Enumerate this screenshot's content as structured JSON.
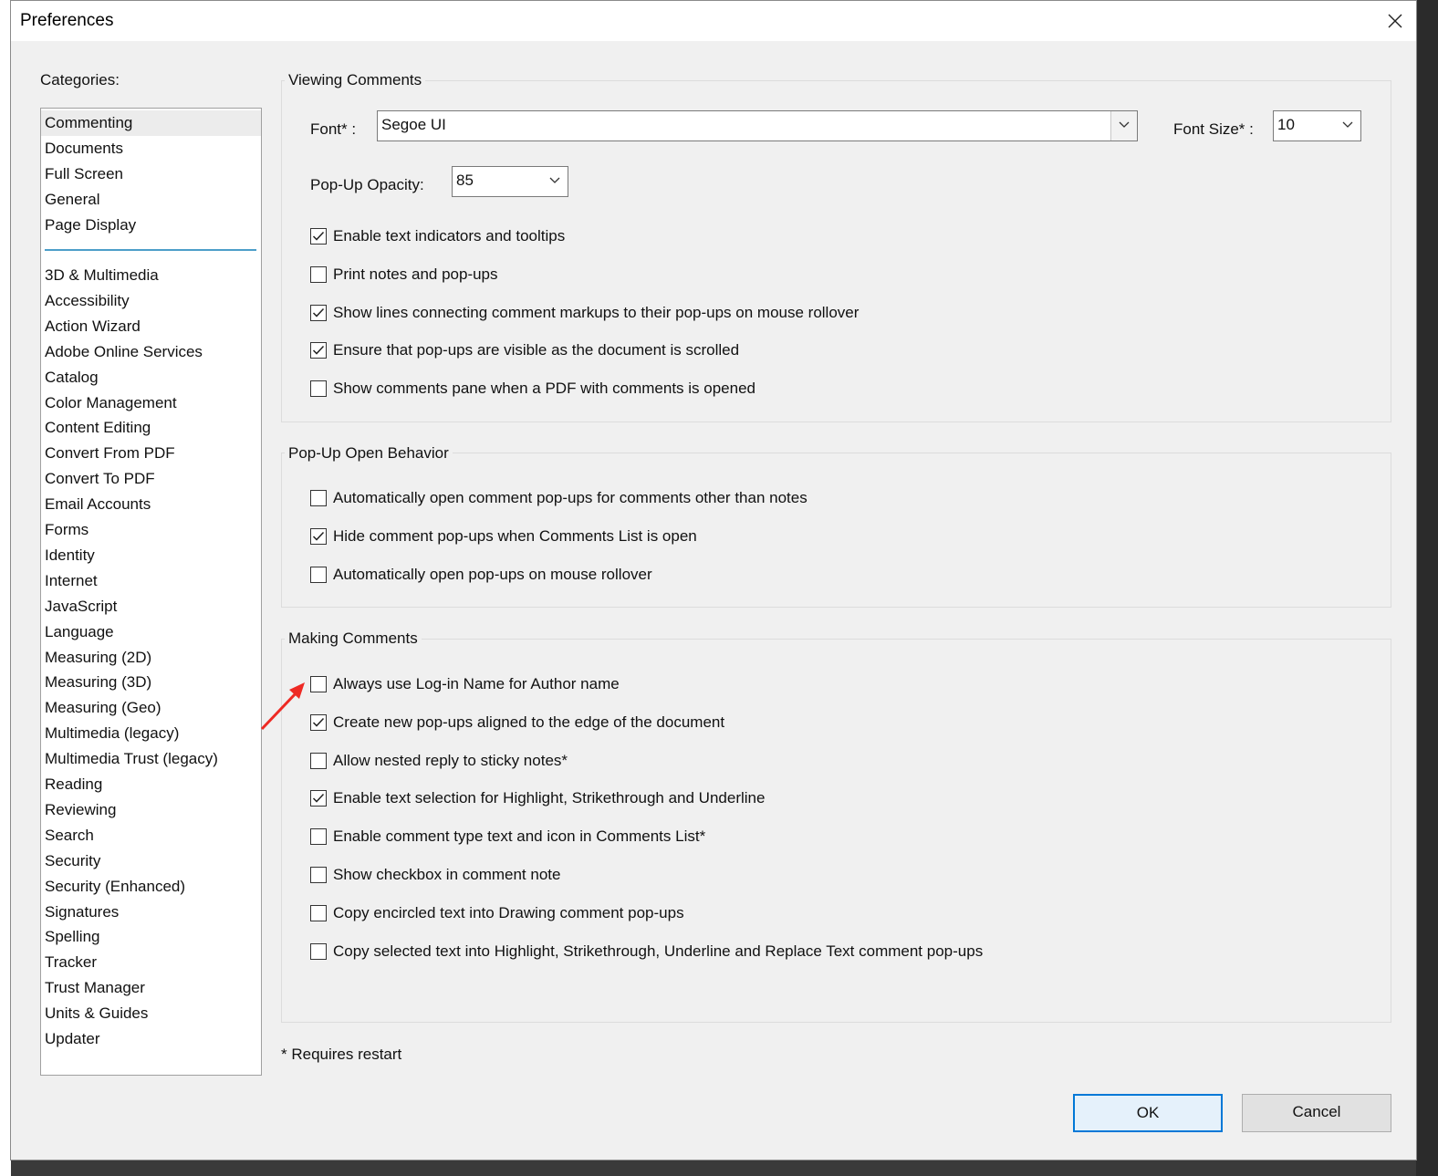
{
  "window": {
    "title": "Preferences"
  },
  "sidebar": {
    "label": "Categories:",
    "top_items": [
      "Commenting",
      "Documents",
      "Full Screen",
      "General",
      "Page Display"
    ],
    "selected": "Commenting",
    "items": [
      "3D & Multimedia",
      "Accessibility",
      "Action Wizard",
      "Adobe Online Services",
      "Catalog",
      "Color Management",
      "Content Editing",
      "Convert From PDF",
      "Convert To PDF",
      "Email Accounts",
      "Forms",
      "Identity",
      "Internet",
      "JavaScript",
      "Language",
      "Measuring (2D)",
      "Measuring (3D)",
      "Measuring (Geo)",
      "Multimedia (legacy)",
      "Multimedia Trust (legacy)",
      "Reading",
      "Reviewing",
      "Search",
      "Security",
      "Security (Enhanced)",
      "Signatures",
      "Spelling",
      "Tracker",
      "Trust Manager",
      "Units & Guides",
      "Updater"
    ]
  },
  "viewing": {
    "title": "Viewing Comments",
    "font_label": "Font* :",
    "font_value": "Segoe UI",
    "font_size_label": "Font Size* :",
    "font_size_value": "10",
    "opacity_label": "Pop-Up Opacity:",
    "opacity_value": "85",
    "options": [
      {
        "label": "Enable text indicators and tooltips",
        "checked": true
      },
      {
        "label": "Print notes and pop-ups",
        "checked": false
      },
      {
        "label": "Show lines connecting comment markups to their pop-ups on mouse rollover",
        "checked": true
      },
      {
        "label": "Ensure that pop-ups are visible as the document is scrolled",
        "checked": true
      },
      {
        "label": "Show comments pane when a PDF with comments is opened",
        "checked": false
      }
    ]
  },
  "popup_behavior": {
    "title": "Pop-Up Open Behavior",
    "options": [
      {
        "label": "Automatically open comment pop-ups for comments other than notes",
        "checked": false
      },
      {
        "label": "Hide comment pop-ups when Comments List is open",
        "checked": true
      },
      {
        "label": "Automatically open pop-ups on mouse rollover",
        "checked": false
      }
    ]
  },
  "making": {
    "title": "Making Comments",
    "options": [
      {
        "label": "Always use Log-in Name for Author name",
        "checked": false
      },
      {
        "label": "Create new pop-ups aligned to the edge of the document",
        "checked": true
      },
      {
        "label": "Allow nested reply to sticky notes*",
        "checked": false
      },
      {
        "label": "Enable text selection for Highlight, Strikethrough and Underline",
        "checked": true
      },
      {
        "label": "Enable comment type text and icon in Comments List*",
        "checked": false
      },
      {
        "label": "Show checkbox in comment note",
        "checked": false
      },
      {
        "label": "Copy encircled text into Drawing comment pop-ups",
        "checked": false
      },
      {
        "label": "Copy selected text into Highlight, Strikethrough, Underline and Replace Text comment pop-ups",
        "checked": false
      }
    ]
  },
  "footer": {
    "note": "* Requires restart",
    "ok_label": "OK",
    "cancel_label": "Cancel"
  },
  "colors": {
    "accent": "#0078d7",
    "separator": "#4c9ec9",
    "annotation_arrow": "#ee2a24"
  },
  "icons": {
    "close": "close-icon",
    "dropdown": "chevron-down-icon",
    "check": "checkmark-icon"
  }
}
